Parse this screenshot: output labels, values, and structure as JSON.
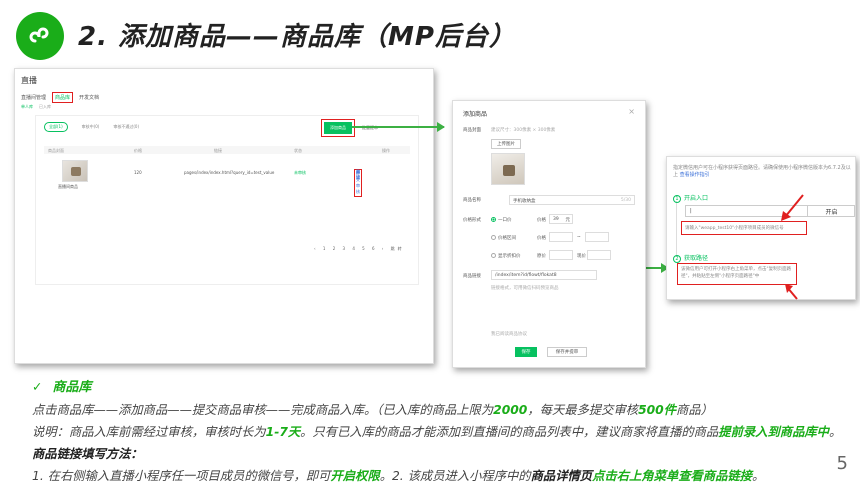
{
  "slide": {
    "title": "2. 添加商品——商品库（MP后台）",
    "page_number": "5"
  },
  "shot1": {
    "header": "直播",
    "tabs": [
      "直播间管理",
      "商品库",
      "开发文档"
    ],
    "subtabs": [
      "单人库",
      "已入库"
    ],
    "filters": [
      "全部(1)",
      "审核中(0)",
      "审核不通过(0)"
    ],
    "add_button": "添加商品",
    "batch": "批量提审",
    "columns": [
      "商品封面",
      "价格",
      "链接",
      "状态",
      "操作"
    ],
    "row": {
      "name": "直播间商品",
      "price": "120",
      "link": "pages/index/index.html?query_id=test_value",
      "status": "未审核",
      "op_submit": "提交审核",
      "op_edit": "编辑",
      "op_delete": "删除"
    },
    "pager": "‹ 1 2 3 4 5 6 ›  跳转"
  },
  "shot2": {
    "title": "添加商品",
    "close": "×",
    "label_cover": "商品封面",
    "cover_hint": "建议尺寸：300像素 × 300像素",
    "upload": "上传图片",
    "label_name": "商品名称",
    "name_value": "手机收纳盒",
    "name_count": "5/30",
    "label_price": "价格形式",
    "price_opt1": "一口价",
    "price_opt1_label": "价格",
    "price_opt1_value": "39",
    "price_opt1_unit": "元",
    "price_opt2": "价格区间",
    "price_opt2_label": "价格",
    "price_opt3": "显示折扣价",
    "price_opt3_label": "原价",
    "price_opt3_label2": "现价",
    "range_dash": "~",
    "label_link": "商品链接",
    "link_value": "/index/item?id/flowt/flokat8",
    "link_hint": "链接格式，可用微信扫码预览商品",
    "terms": "我已阅读商品协议",
    "save": "保存",
    "submit": "保存并提审"
  },
  "shot3": {
    "desc": "指定微信用户可在小程序获得页面路径。请确保使用小程序微信版本为6.7.2及以上",
    "desc_link": "查看操作指引",
    "step1": "开启入口",
    "step1_num": "1",
    "input_placeholder": "|",
    "enable_button": "开启",
    "step1_hint": "请输入\"weapp_test10\"小程序项目成员的微信号",
    "step2": "获取路径",
    "step2_num": "2",
    "step2_hint": "该微信用户可打开小程序右上角菜单，点击\"复制页面路径\"，并粘贴至左侧\"小程序页面路径\"中"
  },
  "notes": {
    "check": "✓",
    "heading": "商品库",
    "line1_a": "点击商品库——添加商品——提交商品审核——完成商品入库。（已入库的商品上限为",
    "line1_b": "2000",
    "line1_c": "，每天最多提交审核",
    "line1_d": "500件",
    "line1_e": "商品）",
    "line2_a": "说明：商品入库前需经过审核，审核时长为",
    "line2_b": "1-7天",
    "line2_c": "。只有已入库的商品才能添加到直播间的商品列表中，建议商家将直播的商品",
    "line2_d": "提前录入到商品库中",
    "line2_e": "。",
    "line3": "商品链接填写方法：",
    "line4_a": "1. 在右侧输入直播小程序任一项目成员的微信号，即可",
    "line4_b": "开启权限",
    "line4_c": "。2. 该成员进入小程序中的",
    "line4_d": "商品详情页",
    "line4_e": "点击右上角菜单查看商品链接",
    "line4_f": "。"
  }
}
